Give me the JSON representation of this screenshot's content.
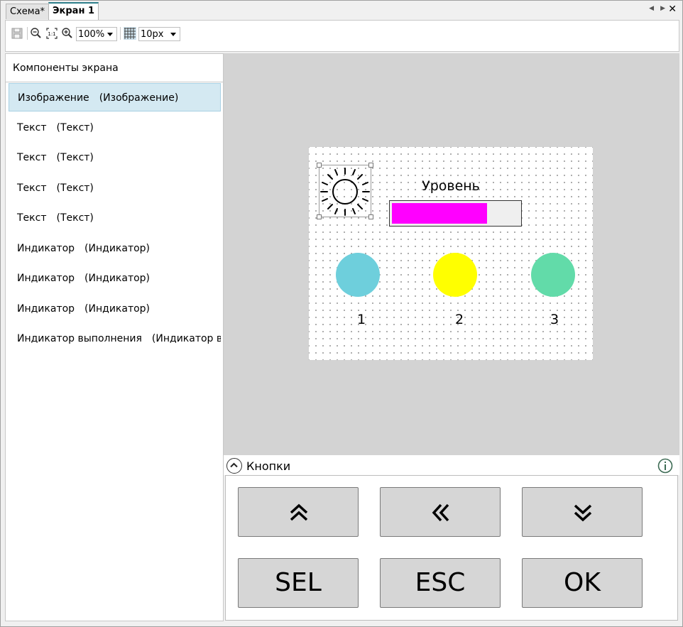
{
  "tabs": [
    {
      "label": "Схема*",
      "active": false
    },
    {
      "label": "Экран 1",
      "active": true
    }
  ],
  "toolbar": {
    "zoom": "100%",
    "grid_size": "10px"
  },
  "components_panel": {
    "title": "Компоненты экрана",
    "items": [
      {
        "name": "Изображение",
        "kind": "(Изображение)",
        "selected": true
      },
      {
        "name": "Текст",
        "kind": "(Текст)",
        "selected": false
      },
      {
        "name": "Текст",
        "kind": "(Текст)",
        "selected": false
      },
      {
        "name": "Текст",
        "kind": "(Текст)",
        "selected": false
      },
      {
        "name": "Текст",
        "kind": "(Текст)",
        "selected": false
      },
      {
        "name": "Индикатор",
        "kind": "(Индикатор)",
        "selected": false
      },
      {
        "name": "Индикатор",
        "kind": "(Индикатор)",
        "selected": false
      },
      {
        "name": "Индикатор",
        "kind": "(Индикатор)",
        "selected": false
      },
      {
        "name": "Индикатор выполнения",
        "kind": "(Индикатор вып",
        "selected": false
      }
    ]
  },
  "screen": {
    "level_label": "Уровень",
    "progress_fraction": 0.75,
    "progress_color": "#ff00ff",
    "indicators": [
      {
        "label": "1",
        "color": "#6ecfdc"
      },
      {
        "label": "2",
        "color": "#ffff00"
      },
      {
        "label": "3",
        "color": "#62dba9"
      }
    ],
    "image_icon": "sun-icon"
  },
  "buttons_panel": {
    "title": "Кнопки",
    "buttons": [
      {
        "icon": "double-chevron-up-icon",
        "label": ""
      },
      {
        "icon": "double-chevron-left-icon",
        "label": ""
      },
      {
        "icon": "double-chevron-down-icon",
        "label": ""
      },
      {
        "icon": "",
        "label": "SEL"
      },
      {
        "icon": "",
        "label": "ESC"
      },
      {
        "icon": "",
        "label": "OK"
      }
    ]
  },
  "colors": {
    "selected_row": "#d4e9f2",
    "canvas_bg": "#d3d3d3",
    "active_tab_accent": "#2e7e8a"
  }
}
